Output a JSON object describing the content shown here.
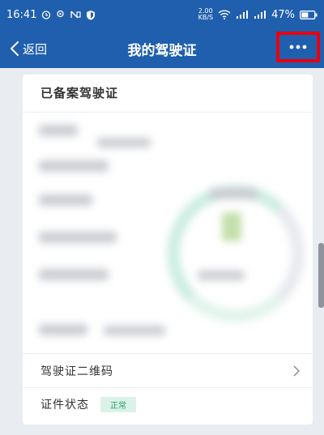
{
  "status_bar": {
    "time": "16:41",
    "net_speed_value": "2.00",
    "net_speed_unit": "KB/S",
    "battery": "47%"
  },
  "nav": {
    "back_label": "返回",
    "title": "我的驾驶证"
  },
  "card": {
    "title": "已备案驾驶证"
  },
  "rows": {
    "qr_label": "驾驶证二维码",
    "status_label": "证件状态",
    "status_value": "正常"
  },
  "colors": {
    "nav_bg": "#1f5fae",
    "highlight": "#e8000d",
    "status_green": "#2a9e6e"
  }
}
